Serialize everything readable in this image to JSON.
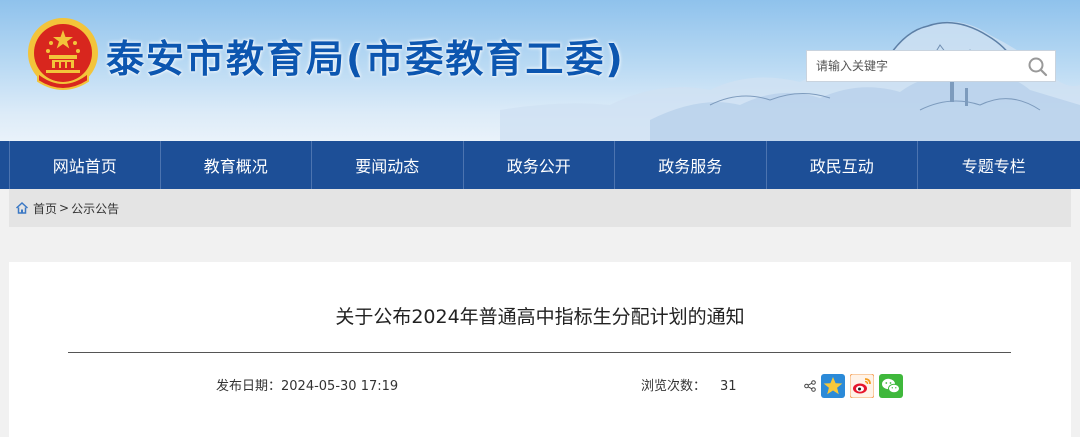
{
  "header": {
    "site_title": "泰安市教育局(市委教育工委)",
    "search_placeholder": "请输入关键字"
  },
  "nav": {
    "items": [
      "网站首页",
      "教育概况",
      "要闻动态",
      "政务公开",
      "政务服务",
      "政民互动",
      "专题专栏"
    ]
  },
  "breadcrumb": {
    "home": "首页",
    "separator": ">",
    "current": "公示公告"
  },
  "article": {
    "title": "关于公布2024年普通高中指标生分配计划的通知",
    "date_label": "发布日期：",
    "date_value": "2024-05-30 17:19",
    "views_label": "浏览次数：",
    "views_value": "31"
  },
  "share": {
    "icons": [
      "share-icon",
      "qzone-icon",
      "weibo-icon",
      "wechat-icon"
    ]
  },
  "colors": {
    "nav_bg": "#1d4f97",
    "title_blue": "#0c56b0",
    "emblem_red": "#d8261e",
    "emblem_gold": "#f3c43a"
  }
}
